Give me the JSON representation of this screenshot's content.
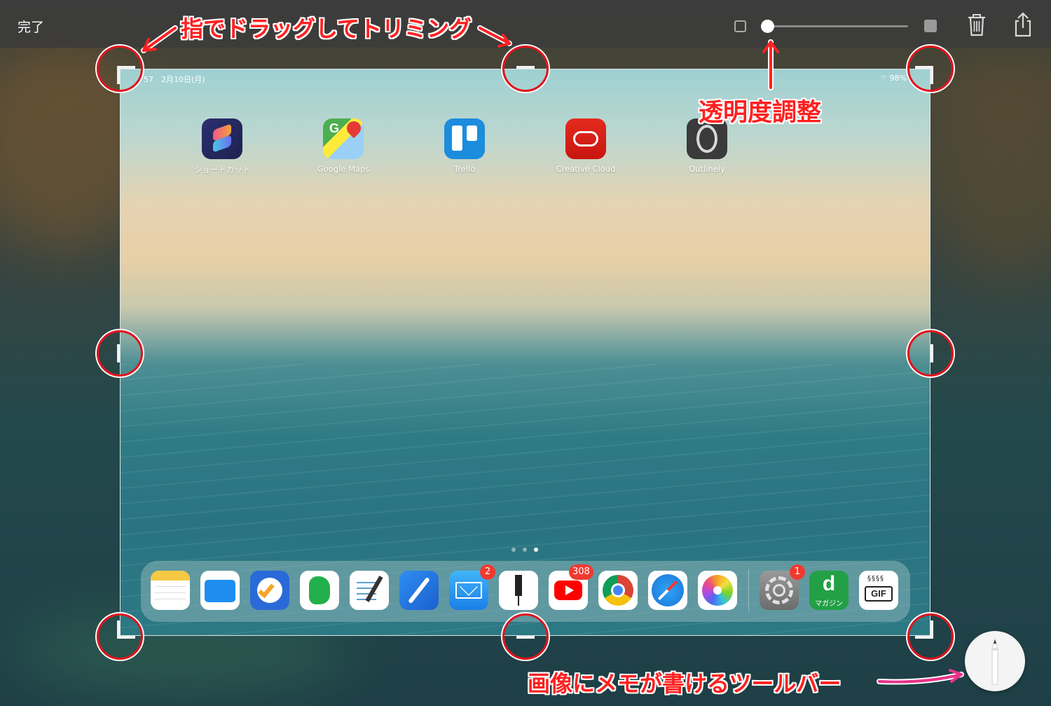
{
  "toolbar": {
    "done_label": "完了",
    "opacity_value": 0.0
  },
  "screenshot": {
    "status_left": "57　2月10日(月)",
    "status_right": "98%",
    "home_apps": [
      {
        "label": "ショートカット",
        "icon": "shortcuts-icon"
      },
      {
        "label": "Google Maps",
        "icon": "google-maps-icon"
      },
      {
        "label": "Trello",
        "icon": "trello-icon"
      },
      {
        "label": "Creative Cloud",
        "icon": "creative-cloud-icon"
      },
      {
        "label": "Outlinely",
        "icon": "outlinely-icon"
      }
    ],
    "page_count": 3,
    "current_page": 3,
    "dock_apps": [
      {
        "icon": "notes-icon"
      },
      {
        "icon": "files-icon"
      },
      {
        "icon": "omnifocus-icon"
      },
      {
        "icon": "evernote-icon"
      },
      {
        "icon": "notes-pen-icon"
      },
      {
        "icon": "pen-app-icon"
      },
      {
        "icon": "mail-icon",
        "badge": "2"
      },
      {
        "icon": "pen-tool-icon"
      },
      {
        "icon": "youtube-icon",
        "badge": "308"
      },
      {
        "icon": "chrome-icon"
      },
      {
        "icon": "safari-icon"
      },
      {
        "icon": "photos-icon"
      },
      {
        "icon": "settings-icon",
        "badge": "1"
      },
      {
        "icon": "d-magazine-icon",
        "label": "マガジン"
      },
      {
        "icon": "gif-maker-icon",
        "label": "GIF"
      }
    ]
  },
  "annotations": {
    "trim": "指でドラッグしてトリミング",
    "opacity": "透明度調整",
    "toolbar": "画像にメモが書けるツールバー"
  },
  "colors": {
    "annotation": "#ff2020",
    "handle_ring": "#e0141d",
    "toolbar_bg": "#3c3c3c"
  }
}
